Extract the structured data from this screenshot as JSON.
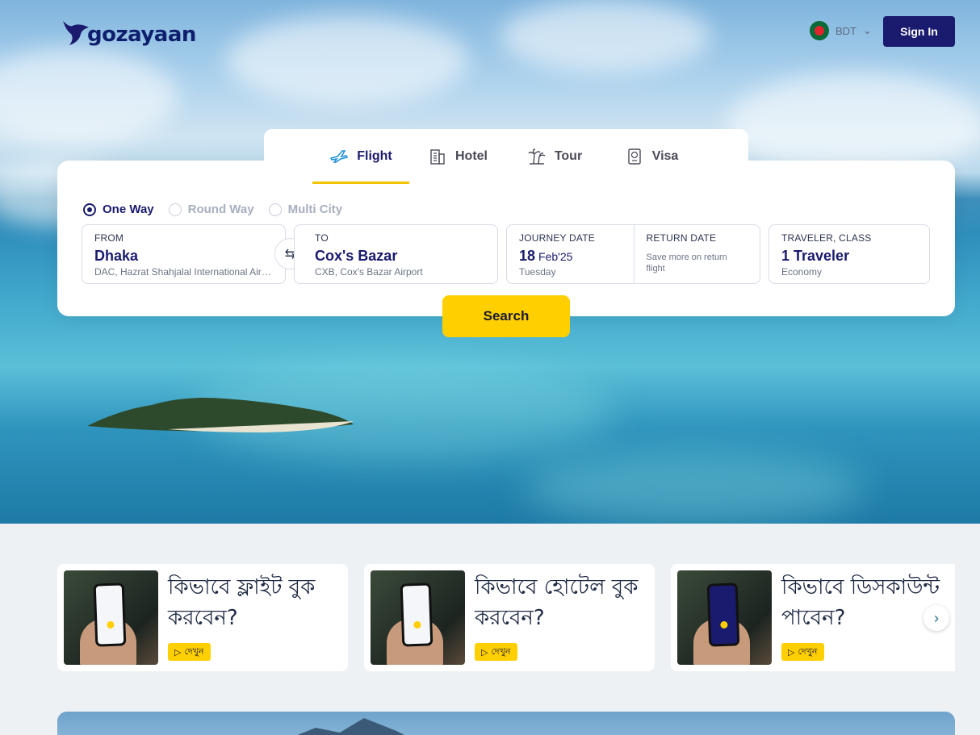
{
  "header": {
    "logo_text": "gozayaan",
    "currency": "BDT",
    "sign_in": "Sign In"
  },
  "tabs": [
    {
      "label": "Flight",
      "icon": "airplane-icon",
      "active": true
    },
    {
      "label": "Hotel",
      "icon": "building-icon",
      "active": false
    },
    {
      "label": "Tour",
      "icon": "palm-tree-icon",
      "active": false
    },
    {
      "label": "Visa",
      "icon": "passport-icon",
      "active": false
    }
  ],
  "trip_types": [
    {
      "label": "One Way",
      "selected": true
    },
    {
      "label": "Round Way",
      "selected": false
    },
    {
      "label": "Multi City",
      "selected": false
    }
  ],
  "search": {
    "from": {
      "label": "FROM",
      "city": "Dhaka",
      "airport": "DAC, Hazrat Shahjalal International Airport"
    },
    "to": {
      "label": "TO",
      "city": "Cox's Bazar",
      "airport": "CXB, Cox's Bazar Airport"
    },
    "journey": {
      "label": "JOURNEY DATE",
      "day": "18",
      "month": "Feb'25",
      "weekday": "Tuesday"
    },
    "return": {
      "label": "RETURN DATE",
      "note": "Save more on return flight"
    },
    "traveler": {
      "label": "TRAVELER, CLASS",
      "value": "1 Traveler",
      "class": "Economy"
    },
    "button": "Search"
  },
  "promos": [
    {
      "title": "কিভাবে ফ্লাইট বুক করবেন?",
      "action": "দেখুন"
    },
    {
      "title": "কিভাবে হোটেল বুক করবেন?",
      "action": "দেখুন"
    },
    {
      "title": "কিভাবে ডিসকাউন্ট পাবেন?",
      "action": "দেখুন"
    }
  ],
  "colors": {
    "brand": "#1a1a6e",
    "accent": "#ffcf00"
  }
}
